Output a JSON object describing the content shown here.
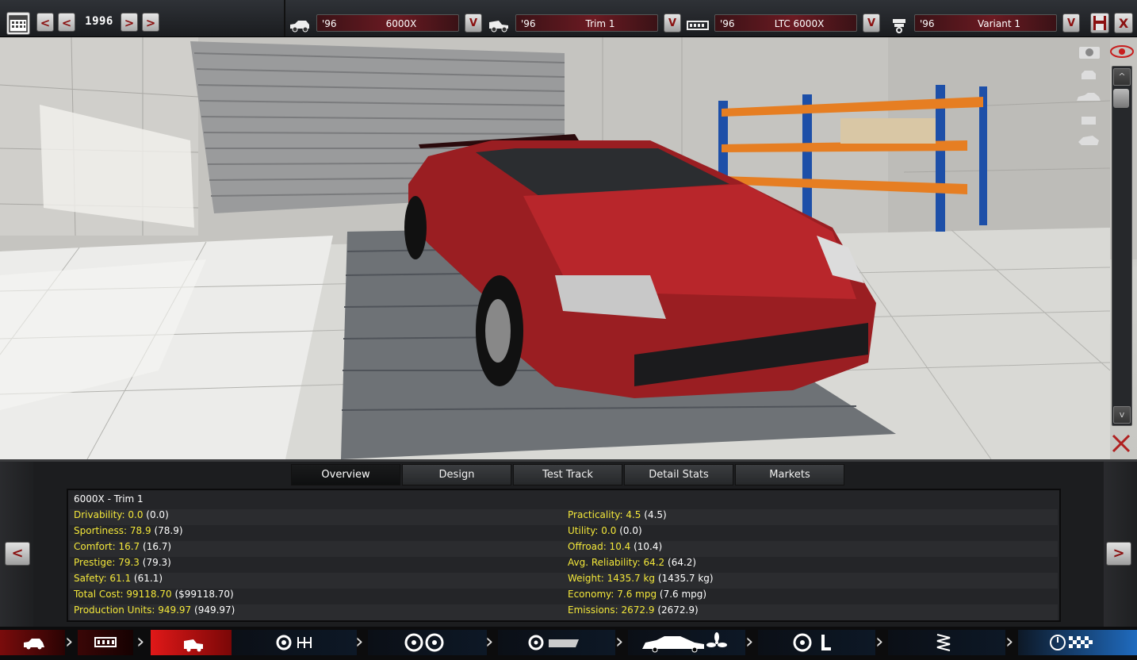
{
  "topbar": {
    "year": "1996",
    "nav_prev2": "<",
    "nav_prev1": "<",
    "nav_next1": ">",
    "nav_next2": ">",
    "selectors": [
      {
        "year": "'96",
        "name": "6000X",
        "dropdown": "V"
      },
      {
        "year": "'96",
        "name": "Trim 1",
        "dropdown": "V"
      },
      {
        "year": "'96",
        "name": "LTC 6000X",
        "dropdown": "V"
      },
      {
        "year": "'96",
        "name": "Variant 1",
        "dropdown": "V"
      }
    ],
    "close_label": "X"
  },
  "viewport": {
    "scroll_up": "^",
    "scroll_down": "v"
  },
  "tabs": [
    {
      "label": "Overview",
      "active": true
    },
    {
      "label": "Design",
      "active": false
    },
    {
      "label": "Test Track",
      "active": false
    },
    {
      "label": "Detail Stats",
      "active": false
    },
    {
      "label": "Markets",
      "active": false
    }
  ],
  "stats": {
    "title": "6000X - Trim 1",
    "left": [
      {
        "key": "Drivability: 0.0",
        "paren": "(0.0)"
      },
      {
        "key": "Sportiness: 78.9",
        "paren": "(78.9)"
      },
      {
        "key": "Comfort: 16.7",
        "paren": "(16.7)"
      },
      {
        "key": "Prestige: 79.3",
        "paren": "(79.3)"
      },
      {
        "key": "Safety: 61.1",
        "paren": "(61.1)"
      },
      {
        "key": "Total Cost: 99118.70",
        "paren": "($99118.70)"
      },
      {
        "key": "Production Units: 949.97",
        "paren": "(949.97)"
      }
    ],
    "right": [
      {
        "key": "Practicality: 4.5",
        "paren": "(4.5)"
      },
      {
        "key": "Utility: 0.0",
        "paren": "(0.0)"
      },
      {
        "key": "Offroad: 10.4",
        "paren": "(10.4)"
      },
      {
        "key": "Avg. Reliability: 64.2",
        "paren": "(64.2)"
      },
      {
        "key": "Weight: 1435.7 kg",
        "paren": "(1435.7 kg)"
      },
      {
        "key": "Economy: 7.6 mpg",
        "paren": "(7.6 mpg)"
      },
      {
        "key": "Emissions: 2672.9",
        "paren": "(2672.9)"
      }
    ]
  },
  "panel_nav": {
    "prev": "<",
    "next": ">"
  },
  "colors": {
    "accent_red": "#8a1010",
    "stat_key": "#f3e73a",
    "car_red": "#9a1e22"
  },
  "bottom_nav": [
    {
      "icon": "car-model-icon",
      "active": false
    },
    {
      "icon": "chassis-icon",
      "active": false
    },
    {
      "icon": "trim-icon",
      "active": true
    },
    {
      "icon": "gearbox-icon",
      "active": false
    },
    {
      "icon": "wheels-icon",
      "active": false
    },
    {
      "icon": "body-aero-icon",
      "active": false
    },
    {
      "icon": "interior-icon",
      "active": false
    },
    {
      "icon": "suspension-icon",
      "active": false
    },
    {
      "icon": "test-finish-icon",
      "active": false
    }
  ]
}
